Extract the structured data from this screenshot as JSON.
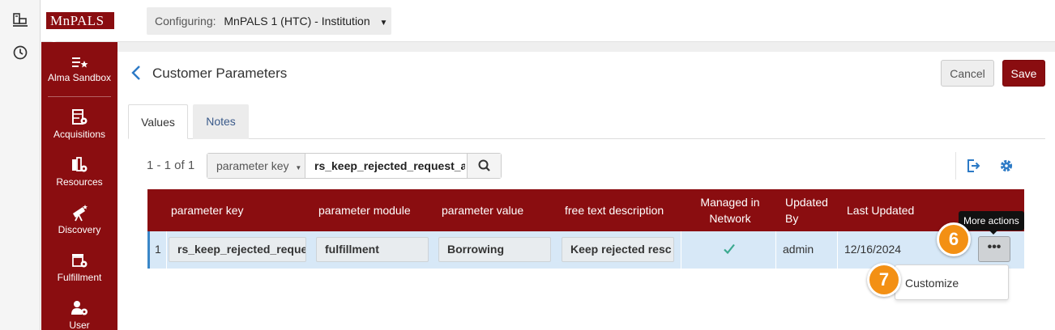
{
  "app": {
    "logo_text": "MnPALS 1",
    "configuring_label": "Configuring:",
    "configuring_value": "MnPALS 1 (HTC) - Institution"
  },
  "rail": {
    "icons": [
      "library-icon",
      "history-clock-icon"
    ]
  },
  "nav": {
    "items": [
      {
        "label": "Alma Sandbox",
        "icon": "list-star-icon"
      },
      {
        "label": "Acquisitions",
        "icon": "acquisitions-icon"
      },
      {
        "label": "Resources",
        "icon": "resources-icon"
      },
      {
        "label": "Discovery",
        "icon": "telescope-icon"
      },
      {
        "label": "Fulfillment",
        "icon": "fulfillment-icon"
      },
      {
        "label": "User",
        "icon": "user-gear-icon"
      }
    ]
  },
  "page": {
    "title": "Customer Parameters",
    "cancel_label": "Cancel",
    "save_label": "Save"
  },
  "tabs": [
    {
      "label": "Values",
      "active": true
    },
    {
      "label": "Notes",
      "active": false
    }
  ],
  "toolbar": {
    "count": "1 - 1 of 1",
    "search_key": "parameter key",
    "search_value": "rs_keep_rejected_request_a"
  },
  "table": {
    "headers": {
      "parameter_key": "parameter key",
      "parameter_module": "parameter module",
      "parameter_value": "parameter value",
      "description": "free text description",
      "managed_1": "Managed in",
      "managed_2": "Network",
      "updated_by_1": "Updated",
      "updated_by_2": "By",
      "last_updated": "Last Updated"
    },
    "rows": [
      {
        "num": "1",
        "parameter_key": "rs_keep_rejected_reque",
        "parameter_module": "fulfillment",
        "parameter_value": "Borrowing",
        "description": "Keep rejected resc",
        "managed_in_network": true,
        "updated_by": "admin",
        "last_updated": "12/16/2024",
        "more_label": "•••"
      }
    ]
  },
  "tooltip": "More actions",
  "menu": {
    "items": [
      "Customize"
    ]
  },
  "callouts": [
    "6",
    "7"
  ],
  "colors": {
    "brand": "#8a0d10",
    "row_selected": "#d7e8f7",
    "accent_blue": "#2c7ac6",
    "callout": "#f39014",
    "check": "#3aa98f"
  }
}
